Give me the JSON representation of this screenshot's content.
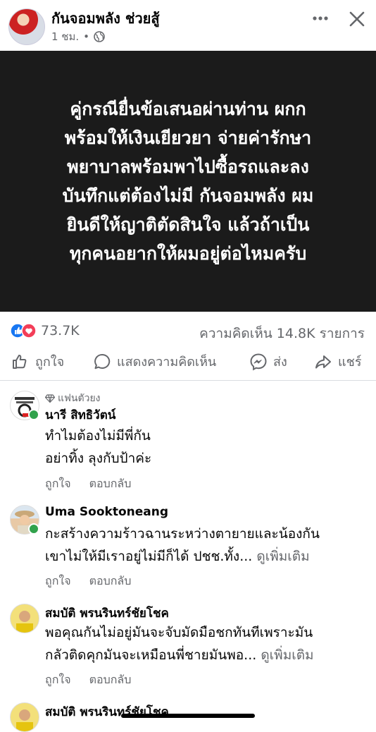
{
  "header": {
    "page_name": "กันจอมพลัง ช่วยสู้",
    "post_time": "1 ชม.",
    "separator": "•"
  },
  "post": {
    "text_lines": [
      "คู่กรณียื่นข้อเสนอผ่านท่าน ผกก",
      "พร้อมให้เงินเยียวยา จ่ายค่ารักษา",
      "พยาบาลพร้อมพาไปซื้อรถและลง",
      "บันทึกแต่ต้องไม่มี กันจอมพลัง ผม",
      "ยินดีให้ญาติตัดสินใจ แล้วถ้าเป็น",
      "ทุกคนอยากให้ผมอยู่ต่อไหมครับ"
    ]
  },
  "stats": {
    "reactions": "73.7K",
    "comments": "ความคิดเห็น 14.8K รายการ"
  },
  "actions": {
    "like": "ถูกใจ",
    "comment": "แสดงความคิดเห็น",
    "send": "ส่ง",
    "share": "แชร์"
  },
  "comments": [
    {
      "badge": "แฟนตัวยง",
      "name": "นารี สิทธิวัตน์",
      "lines": [
        "ทำไมต้องไม่มีพี่กัน",
        "อย่าทิ้ง ลุงกับป้าค่ะ"
      ],
      "see_more": "",
      "like": "ถูกใจ",
      "reply": "ตอบกลับ"
    },
    {
      "name": "Uma Sooktoneang",
      "lines": [
        "กะสร้างความร้าวฉานระหว่างตายายและน้องกัน",
        "เขาไม่ให้มีเราอยู่ไม่มีก็ได้ ปชช.ทั้ง..."
      ],
      "see_more": "ดูเพิ่มเติม",
      "like": "ถูกใจ",
      "reply": "ตอบกลับ"
    },
    {
      "name": "สมบัติ พรนรินทร์ชัยโชค",
      "lines": [
        "พอคุณกันไม่อยู่มันจะจับมัดมือชกทันทีเพราะมัน",
        "กลัวติดคุกมันจะเหมือนพี่ชายมันพอ..."
      ],
      "see_more": "ดูเพิ่มเติม",
      "like": "ถูกใจ",
      "reply": "ตอบกลับ"
    },
    {
      "name": "สมบัติ พรนรินทร์ชัยโชค"
    }
  ],
  "colors": {
    "image_bg": "#1b1b1b",
    "secondary_text": "#65676b",
    "like_blue": "#1877f2",
    "love_red": "#f33e58",
    "online_green": "#31a24c"
  }
}
